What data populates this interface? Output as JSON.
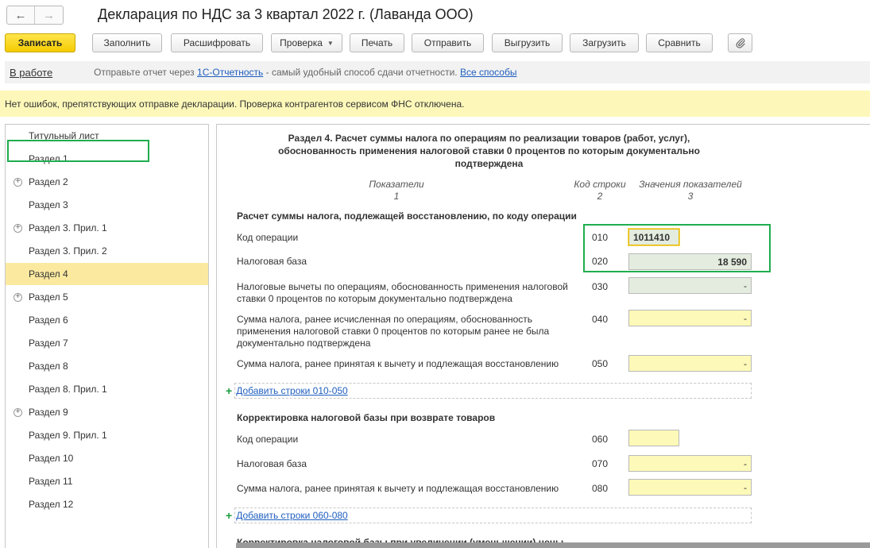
{
  "window": {
    "title": "Декларация по НДС за 3 квартал 2022 г. (Лаванда ООО)",
    "nav_back": "←",
    "nav_forward": "→"
  },
  "toolbar": {
    "save": "Записать",
    "fill": "Заполнить",
    "decode": "Расшифровать",
    "check": "Проверка",
    "print": "Печать",
    "send": "Отправить",
    "export": "Выгрузить",
    "import": "Загрузить",
    "compare": "Сравнить"
  },
  "status": {
    "state": "В работе",
    "text_before": "Отправьте отчет через",
    "link_1c": "1С-Отчетность",
    "text_middle": "- самый удобный способ сдачи отчетности.",
    "link_all": "Все способы"
  },
  "info": {
    "message": "Нет ошибок, препятствующих отправке декларации. Проверка контрагентов сервисом ФНС отключена."
  },
  "tree": {
    "items": [
      {
        "label": "Титульный лист",
        "expandable": false,
        "selected": false
      },
      {
        "label": "Раздел 1",
        "expandable": false,
        "selected": false
      },
      {
        "label": "Раздел 2",
        "expandable": true,
        "selected": false
      },
      {
        "label": "Раздел 3",
        "expandable": false,
        "selected": false
      },
      {
        "label": "Раздел 3. Прил. 1",
        "expandable": true,
        "selected": false
      },
      {
        "label": "Раздел 3. Прил. 2",
        "expandable": false,
        "selected": false
      },
      {
        "label": "Раздел 4",
        "expandable": false,
        "selected": true
      },
      {
        "label": "Раздел 5",
        "expandable": true,
        "selected": false
      },
      {
        "label": "Раздел 6",
        "expandable": false,
        "selected": false
      },
      {
        "label": "Раздел 7",
        "expandable": false,
        "selected": false
      },
      {
        "label": "Раздел 8",
        "expandable": false,
        "selected": false
      },
      {
        "label": "Раздел 8. Прил. 1",
        "expandable": false,
        "selected": false
      },
      {
        "label": "Раздел 9",
        "expandable": true,
        "selected": false
      },
      {
        "label": "Раздел 9. Прил. 1",
        "expandable": false,
        "selected": false
      },
      {
        "label": "Раздел 10",
        "expandable": false,
        "selected": false
      },
      {
        "label": "Раздел 11",
        "expandable": false,
        "selected": false
      },
      {
        "label": "Раздел 12",
        "expandable": false,
        "selected": false
      }
    ]
  },
  "form": {
    "section_title": "Раздел 4. Расчет суммы налога по операциям по реализации товаров (работ, услуг), обоснованность применения налоговой ставки 0 процентов по которым документально подтверждена",
    "col_indicators": "Показатели",
    "col_indicators_num": "1",
    "col_code": "Код строки",
    "col_code_num": "2",
    "col_values": "Значения показателей",
    "col_values_num": "3",
    "group1_title": "Расчет суммы налога, подлежащей восстановлению, по коду операции",
    "group1": [
      {
        "label": "Код операции",
        "code": "010",
        "value": "1011410"
      },
      {
        "label": "Налоговая база",
        "code": "020",
        "value": "18 590"
      },
      {
        "label": "Налоговые вычеты по операциям, обоснованность применения налоговой ставки 0 процентов по которым документально подтверждена",
        "code": "030",
        "value": "-"
      },
      {
        "label": "Сумма налога, ранее исчисленная по операциям, обоснованность применения налоговой ставки 0 процентов по которым ранее не была документально подтверждена",
        "code": "040",
        "value": "-"
      },
      {
        "label": "Сумма налога, ранее принятая к вычету и подлежащая восстановлению",
        "code": "050",
        "value": "-"
      }
    ],
    "add_rows_1": "Добавить строки 010-050",
    "group2_title": "Корректировка налоговой базы при возврате товаров",
    "group2": [
      {
        "label": "Код операции",
        "code": "060",
        "value": ""
      },
      {
        "label": "Налоговая база",
        "code": "070",
        "value": "-"
      },
      {
        "label": "Сумма налога, ранее принятая к вычету и подлежащая восстановлению",
        "code": "080",
        "value": "-"
      }
    ],
    "add_rows_2": "Добавить строки 060-080",
    "group3_title_partial": "Корректировка налоговой базы при увеличении (уменьшении) цены"
  },
  "colors": {
    "accent_yellow": "#f5cc00",
    "highlight_green": "#1fad4f",
    "link_blue": "#1f5fbf",
    "info_bg": "#fdf8b9"
  },
  "icons": [
    "back-arrow-icon",
    "forward-arrow-icon",
    "paperclip-icon",
    "expand-plus-icon",
    "add-plus-icon"
  ]
}
